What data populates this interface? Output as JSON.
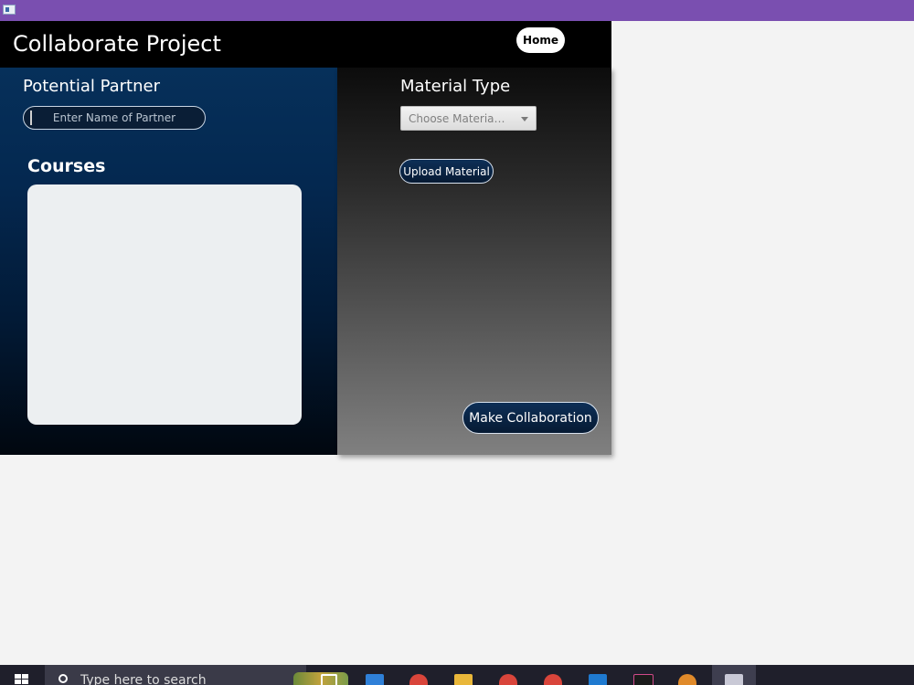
{
  "window": {
    "title_bar_color": "#7a4fb0",
    "icon": "app-window-icon"
  },
  "header": {
    "title": "Collaborate Project",
    "home_label": "Home"
  },
  "left_panel": {
    "partner_label": "Potential Partner",
    "partner_placeholder": "Enter Name of Partner",
    "partner_value": "",
    "courses_label": "Courses",
    "courses_items": []
  },
  "right_panel": {
    "material_label": "Material Type",
    "material_select_text": "Choose Material T...",
    "upload_label": "Upload Material",
    "collaborate_label": "Make Collaboration"
  },
  "taskbar": {
    "search_placeholder": "Type here to search",
    "icons": [
      "windows-start-icon",
      "task-view-icon",
      "vscode-insiders-icon",
      "chrome-icon",
      "file-explorer-icon",
      "chrome-icon",
      "chrome-icon",
      "vscode-icon",
      "intellij-icon",
      "sublime-icon",
      "java-app-icon"
    ]
  },
  "colors": {
    "header_bg": "#000000",
    "left_panel_top": "#06305a",
    "button_bg": "#0d2f57",
    "courses_bg": "#eceff1"
  }
}
